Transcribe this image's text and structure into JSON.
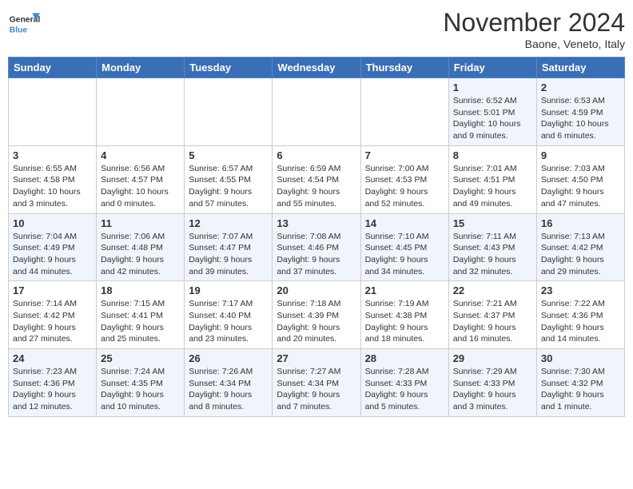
{
  "logo": {
    "general": "General",
    "blue": "Blue"
  },
  "title": "November 2024",
  "location": "Baone, Veneto, Italy",
  "days_of_week": [
    "Sunday",
    "Monday",
    "Tuesday",
    "Wednesday",
    "Thursday",
    "Friday",
    "Saturday"
  ],
  "weeks": [
    [
      {
        "day": "",
        "info": ""
      },
      {
        "day": "",
        "info": ""
      },
      {
        "day": "",
        "info": ""
      },
      {
        "day": "",
        "info": ""
      },
      {
        "day": "",
        "info": ""
      },
      {
        "day": "1",
        "info": "Sunrise: 6:52 AM\nSunset: 5:01 PM\nDaylight: 10 hours and 9 minutes."
      },
      {
        "day": "2",
        "info": "Sunrise: 6:53 AM\nSunset: 4:59 PM\nDaylight: 10 hours and 6 minutes."
      }
    ],
    [
      {
        "day": "3",
        "info": "Sunrise: 6:55 AM\nSunset: 4:58 PM\nDaylight: 10 hours and 3 minutes."
      },
      {
        "day": "4",
        "info": "Sunrise: 6:56 AM\nSunset: 4:57 PM\nDaylight: 10 hours and 0 minutes."
      },
      {
        "day": "5",
        "info": "Sunrise: 6:57 AM\nSunset: 4:55 PM\nDaylight: 9 hours and 57 minutes."
      },
      {
        "day": "6",
        "info": "Sunrise: 6:59 AM\nSunset: 4:54 PM\nDaylight: 9 hours and 55 minutes."
      },
      {
        "day": "7",
        "info": "Sunrise: 7:00 AM\nSunset: 4:53 PM\nDaylight: 9 hours and 52 minutes."
      },
      {
        "day": "8",
        "info": "Sunrise: 7:01 AM\nSunset: 4:51 PM\nDaylight: 9 hours and 49 minutes."
      },
      {
        "day": "9",
        "info": "Sunrise: 7:03 AM\nSunset: 4:50 PM\nDaylight: 9 hours and 47 minutes."
      }
    ],
    [
      {
        "day": "10",
        "info": "Sunrise: 7:04 AM\nSunset: 4:49 PM\nDaylight: 9 hours and 44 minutes."
      },
      {
        "day": "11",
        "info": "Sunrise: 7:06 AM\nSunset: 4:48 PM\nDaylight: 9 hours and 42 minutes."
      },
      {
        "day": "12",
        "info": "Sunrise: 7:07 AM\nSunset: 4:47 PM\nDaylight: 9 hours and 39 minutes."
      },
      {
        "day": "13",
        "info": "Sunrise: 7:08 AM\nSunset: 4:46 PM\nDaylight: 9 hours and 37 minutes."
      },
      {
        "day": "14",
        "info": "Sunrise: 7:10 AM\nSunset: 4:45 PM\nDaylight: 9 hours and 34 minutes."
      },
      {
        "day": "15",
        "info": "Sunrise: 7:11 AM\nSunset: 4:43 PM\nDaylight: 9 hours and 32 minutes."
      },
      {
        "day": "16",
        "info": "Sunrise: 7:13 AM\nSunset: 4:42 PM\nDaylight: 9 hours and 29 minutes."
      }
    ],
    [
      {
        "day": "17",
        "info": "Sunrise: 7:14 AM\nSunset: 4:42 PM\nDaylight: 9 hours and 27 minutes."
      },
      {
        "day": "18",
        "info": "Sunrise: 7:15 AM\nSunset: 4:41 PM\nDaylight: 9 hours and 25 minutes."
      },
      {
        "day": "19",
        "info": "Sunrise: 7:17 AM\nSunset: 4:40 PM\nDaylight: 9 hours and 23 minutes."
      },
      {
        "day": "20",
        "info": "Sunrise: 7:18 AM\nSunset: 4:39 PM\nDaylight: 9 hours and 20 minutes."
      },
      {
        "day": "21",
        "info": "Sunrise: 7:19 AM\nSunset: 4:38 PM\nDaylight: 9 hours and 18 minutes."
      },
      {
        "day": "22",
        "info": "Sunrise: 7:21 AM\nSunset: 4:37 PM\nDaylight: 9 hours and 16 minutes."
      },
      {
        "day": "23",
        "info": "Sunrise: 7:22 AM\nSunset: 4:36 PM\nDaylight: 9 hours and 14 minutes."
      }
    ],
    [
      {
        "day": "24",
        "info": "Sunrise: 7:23 AM\nSunset: 4:36 PM\nDaylight: 9 hours and 12 minutes."
      },
      {
        "day": "25",
        "info": "Sunrise: 7:24 AM\nSunset: 4:35 PM\nDaylight: 9 hours and 10 minutes."
      },
      {
        "day": "26",
        "info": "Sunrise: 7:26 AM\nSunset: 4:34 PM\nDaylight: 9 hours and 8 minutes."
      },
      {
        "day": "27",
        "info": "Sunrise: 7:27 AM\nSunset: 4:34 PM\nDaylight: 9 hours and 7 minutes."
      },
      {
        "day": "28",
        "info": "Sunrise: 7:28 AM\nSunset: 4:33 PM\nDaylight: 9 hours and 5 minutes."
      },
      {
        "day": "29",
        "info": "Sunrise: 7:29 AM\nSunset: 4:33 PM\nDaylight: 9 hours and 3 minutes."
      },
      {
        "day": "30",
        "info": "Sunrise: 7:30 AM\nSunset: 4:32 PM\nDaylight: 9 hours and 1 minute."
      }
    ]
  ]
}
